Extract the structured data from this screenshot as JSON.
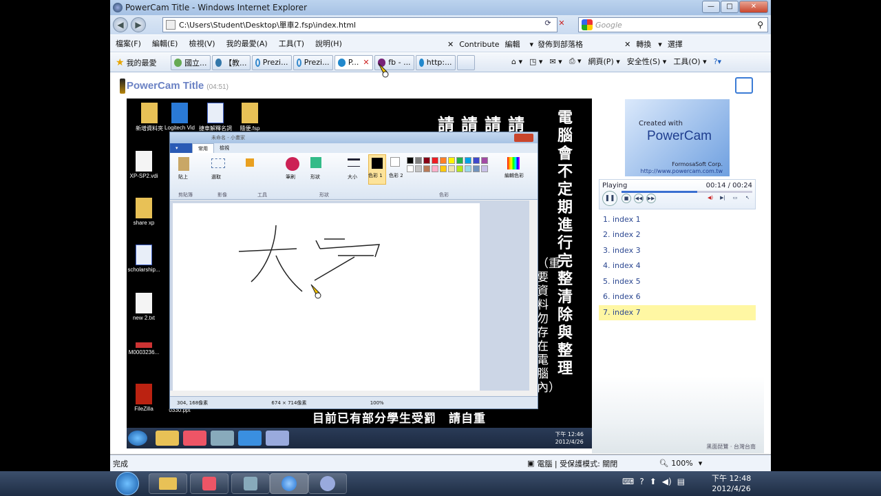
{
  "window": {
    "title": "PowerCam Title - Windows Internet Explorer",
    "min": "—",
    "max": "□",
    "close": "✕"
  },
  "address": {
    "back": "◀",
    "forward": "▶",
    "url": "C:\\Users\\Student\\Desktop\\單車2.fsp\\index.html",
    "refresh": "⟳",
    "stop": "✕",
    "search_placeholder": "Google",
    "search_icon": "⚲"
  },
  "menu": {
    "items": [
      "檔案(F)",
      "編輯(E)",
      "檢視(V)",
      "我的最愛(A)",
      "工具(T)",
      "說明(H)"
    ],
    "contribute": "Contribute",
    "edit": "編輯",
    "publish": "發佈到部落格",
    "convert": "轉換",
    "select": "選擇"
  },
  "favorites": {
    "label": "我的最愛",
    "tabs": [
      "國立...",
      "【教...",
      "Prezi...",
      "Prezi...",
      "P...",
      "fb - ...",
      "http:..."
    ],
    "cmd": [
      "網頁(P) ▾",
      "安全性(S) ▾",
      "工具(O) ▾"
    ]
  },
  "powercam": {
    "title": "PowerCam Title",
    "duration": "(04:51)"
  },
  "video": {
    "desktop_icons": [
      "新增資料夾",
      "Logitech Vid",
      "捷車解釋名詞",
      "隨便.fsp",
      "XP-SP2.vdi",
      "share xp",
      "scholarship...",
      "new 2.txt",
      "M0003236...",
      "FileZilla",
      "0330.ppt"
    ],
    "notice_top": "請請請請",
    "notice_vertical": "電腦會不定期進行完整清除與整理",
    "notice_paren": "（重要資料勿存在電腦內）",
    "notice_bottom": "目前已有部分學生受罰　請自重",
    "paint": {
      "title": "未命名 - 小畫家",
      "tab_home": "常用",
      "tab_view": "檢視",
      "groups": [
        "剪貼簿",
        "影像",
        "工具",
        "形狀",
        "色彩"
      ],
      "paste": "貼上",
      "select": "選取",
      "brush": "筆刷",
      "shapes": "形狀",
      "size": "大小",
      "color1": "色彩 1",
      "color2": "色彩 2",
      "edit_colors": "編輯色彩",
      "status_pos": "304, 168像素",
      "status_size": "674 × 714像素",
      "zoom": "100%"
    },
    "clock_time": "下午 12:46",
    "clock_date": "2012/4/26"
  },
  "player": {
    "promo_created": "Created with",
    "promo_name": "PowerCam",
    "promo_corp": "FormosaSoft Corp.",
    "promo_url": "http://www.powercam.com.tw",
    "state": "Playing",
    "time": "00:14 / 00:24",
    "progress": 0.58
  },
  "index": [
    "1. index 1",
    "2. index 2",
    "3. index 3",
    "4. index 4",
    "5. index 5",
    "6. index 6",
    "7. index 7"
  ],
  "active_index": 6,
  "birds_caption": "黑面琵鷺 · 台灣台南",
  "statusbar": {
    "left": "完成",
    "zone": "電腦 | 受保護模式: 關閉",
    "zoom": "100%"
  },
  "taskbar": {
    "time": "下午 12:48",
    "date": "2012/4/26"
  },
  "colors": {
    "palette": [
      "#000000",
      "#7f7f7f",
      "#880015",
      "#ed1c24",
      "#ff7f27",
      "#fff200",
      "#22b14c",
      "#00a2e8",
      "#3f48cc",
      "#a349a4",
      "#ffffff",
      "#c3c3c3",
      "#b97a57",
      "#ffaec9",
      "#ffc90e",
      "#efe4b0",
      "#b5e61d",
      "#99d9ea",
      "#7092be",
      "#c8bfe7"
    ]
  }
}
